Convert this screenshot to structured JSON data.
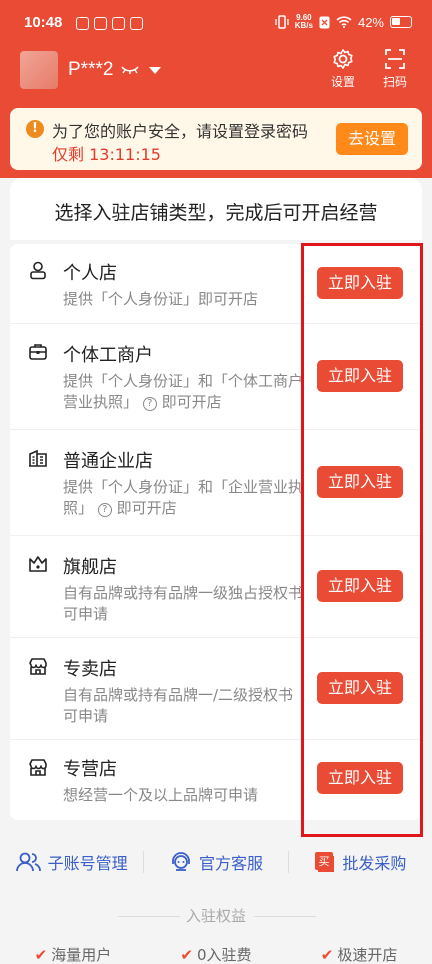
{
  "status_bar": {
    "time": "10:48",
    "net_speed_value": "9.60",
    "net_speed_unit": "KB/s",
    "battery": "42%"
  },
  "header": {
    "username": "P***2",
    "settings_label": "设置",
    "scan_label": "扫码",
    "background_color": "#e94b35"
  },
  "notice": {
    "text": "为了您的账户安全，请设置登录密码",
    "timer": "仅剩 13:11:15",
    "button": "去设置"
  },
  "card_title": "选择入驻店铺类型，完成后可开启经营",
  "stores": [
    {
      "name": "个人店",
      "desc": "提供「个人身份证」即可开店",
      "button": "立即入驻",
      "icon": "person-icon"
    },
    {
      "name": "个体工商户",
      "desc_a": "提供「个人身份证」和「个体工商户营业执照」",
      "desc_b": "即可开店",
      "button": "立即入驻",
      "icon": "briefcase-icon"
    },
    {
      "name": "普通企业店",
      "desc_a": "提供「个人身份证」和「企业营业执照」",
      "desc_b": "即可开店",
      "button": "立即入驻",
      "icon": "building-icon"
    },
    {
      "name": "旗舰店",
      "desc": "自有品牌或持有品牌一级独占授权书可申请",
      "button": "立即入驻",
      "icon": "crown-icon"
    },
    {
      "name": "专卖店",
      "desc": "自有品牌或持有品牌一/二级授权书可申请",
      "button": "立即入驻",
      "icon": "shop-icon"
    },
    {
      "name": "专营店",
      "desc": "想经营一个及以上品牌可申请",
      "button": "立即入驻",
      "icon": "storefront-icon"
    }
  ],
  "bottom_links": {
    "sub_account": "子账号管理",
    "customer_service": "官方客服",
    "wholesale": "批发采购",
    "wholesale_badge": "买"
  },
  "benefits": {
    "title": "入驻权益",
    "items": [
      "海量用户",
      "0入驻费",
      "极速开店"
    ]
  },
  "colors": {
    "primary": "#e94b35",
    "warning": "#ff8a1a",
    "highlight_box": "#e0161b",
    "link": "#3a5fc8"
  }
}
